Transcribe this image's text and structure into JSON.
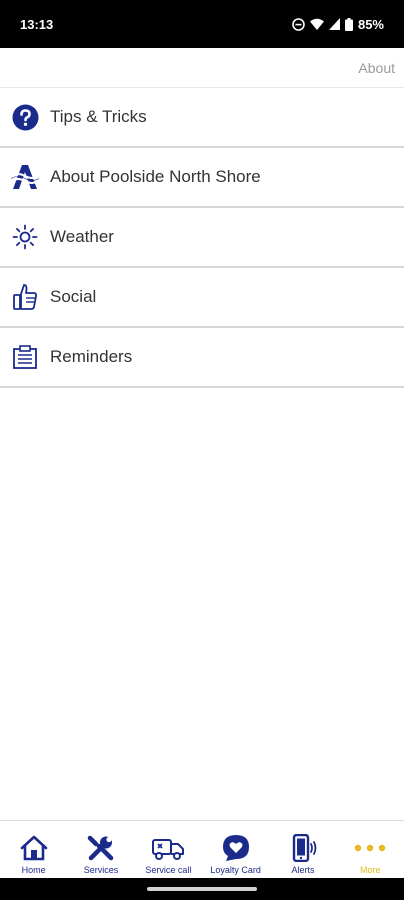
{
  "status_bar": {
    "time": "13:13",
    "battery": "85%",
    "icons": [
      "dnd-icon",
      "wifi-icon",
      "signal-icon",
      "battery-icon"
    ]
  },
  "header": {
    "title": "About"
  },
  "menu": {
    "items": [
      {
        "label": "Tips & Tricks",
        "icon": "question-icon"
      },
      {
        "label": "About Poolside North Shore",
        "icon": "company-logo-icon"
      },
      {
        "label": "Weather",
        "icon": "sun-icon"
      },
      {
        "label": "Social",
        "icon": "thumbs-up-icon"
      },
      {
        "label": "Reminders",
        "icon": "clipboard-icon"
      }
    ]
  },
  "tabs": [
    {
      "label": "Home",
      "icon": "home-icon"
    },
    {
      "label": "Services",
      "icon": "tools-icon"
    },
    {
      "label": "Service call",
      "icon": "truck-icon"
    },
    {
      "label": "Loyalty Card",
      "icon": "heart-icon"
    },
    {
      "label": "Alerts",
      "icon": "phone-vibrate-icon"
    },
    {
      "label": "More",
      "icon": "more-dots-icon",
      "active": true
    }
  ],
  "colors": {
    "brand_blue": "#1b2b8c",
    "active_yellow": "#e6b822",
    "divider": "#d6d6d6"
  }
}
